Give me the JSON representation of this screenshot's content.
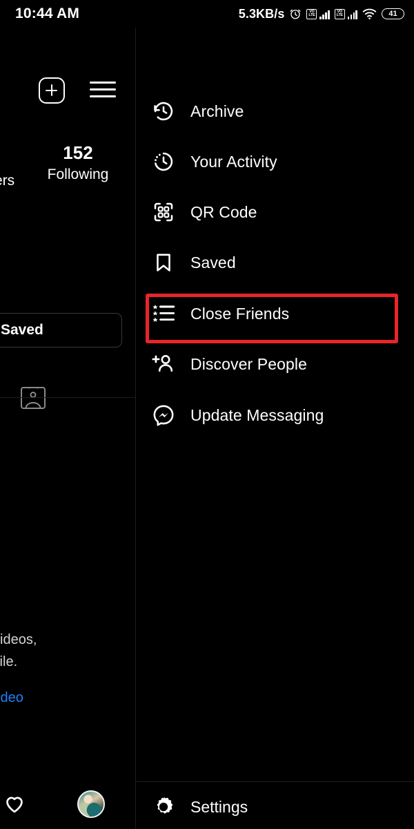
{
  "status_bar": {
    "time": "10:44 AM",
    "net_speed": "5.3KB/s",
    "alarm_icon": "alarm-clock-icon",
    "volte_label_top": "VO",
    "volte_label_bottom": "LTE",
    "sim1_icon": "volte-signal-sim1",
    "sim2_icon": "volte-signal-sim2",
    "wifi_icon": "wifi-icon",
    "battery_level": "41"
  },
  "profile_panel": {
    "add_post_icon": "plus-square-icon",
    "menu_icon": "hamburger-menu-icon",
    "followers_truncated": "ers",
    "following_count": "152",
    "following_label": "Following",
    "saved_tab_label": "Saved",
    "profile_card_icon": "id-card-icon",
    "bio_line_1": "videos,",
    "bio_line_2": "file.",
    "bio_link": "video",
    "heart_icon": "heart-icon",
    "avatar_icon": "profile-avatar"
  },
  "menu": {
    "items": [
      {
        "label": "Archive",
        "icon": "archive-clock-icon",
        "highlighted": false
      },
      {
        "label": "Your Activity",
        "icon": "activity-clock-icon",
        "highlighted": false
      },
      {
        "label": "QR Code",
        "icon": "qr-code-icon",
        "highlighted": false
      },
      {
        "label": "Saved",
        "icon": "bookmark-icon",
        "highlighted": false
      },
      {
        "label": "Close Friends",
        "icon": "star-list-icon",
        "highlighted": true
      },
      {
        "label": "Discover People",
        "icon": "person-add-icon",
        "highlighted": false
      },
      {
        "label": "Update Messaging",
        "icon": "messenger-icon",
        "highlighted": false
      }
    ],
    "settings": {
      "label": "Settings",
      "icon": "gear-icon"
    },
    "highlight_color": "#e8252a"
  },
  "colors": {
    "background": "#000000",
    "text": "#ffffff",
    "link": "#1d82f5",
    "divider": "#1e1e1e",
    "highlight": "#e8252a"
  }
}
